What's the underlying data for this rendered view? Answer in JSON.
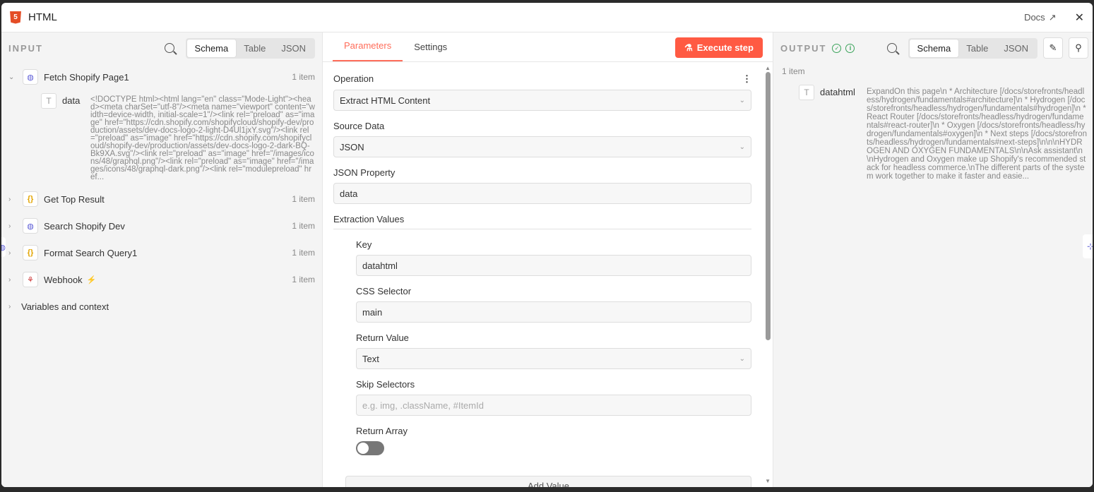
{
  "header": {
    "title": "HTML",
    "docs_label": "Docs"
  },
  "input": {
    "label": "INPUT",
    "views": [
      "Schema",
      "Table",
      "JSON"
    ],
    "nodes": [
      {
        "name": "Fetch Shopify Page1",
        "count": "1 item",
        "icon": "globe-icon"
      },
      {
        "name": "Get Top Result",
        "count": "1 item",
        "icon": "braces-icon"
      },
      {
        "name": "Search Shopify Dev",
        "count": "1 item",
        "icon": "globe-icon"
      },
      {
        "name": "Format Search Query1",
        "count": "1 item",
        "icon": "braces-icon"
      },
      {
        "name": "Webhook",
        "count": "1 item",
        "icon": "webhook-icon"
      }
    ],
    "data_key": "data",
    "data_value": "<!DOCTYPE html><html lang=\"en\" class=\"Mode-Light\"><head><meta charSet=\"utf-8\"/><meta name=\"viewport\" content=\"width=device-width, initial-scale=1\"/><link rel=\"preload\" as=\"image\" href=\"https://cdn.shopify.com/shopifycloud/shopify-dev/production/assets/dev-docs-logo-2-light-D4Ul1jxY.svg\"/><link rel=\"preload\" as=\"image\" href=\"https://cdn.shopify.com/shopifycloud/shopify-dev/production/assets/dev-docs-logo-2-dark-BQ-Bk9XA.svg\"/><link rel=\"preload\" as=\"image\" href=\"/images/icons/48/graphql.png\"/><link rel=\"preload\" as=\"image\" href=\"/images/icons/48/graphql-dark.png\"/><link rel=\"modulepreload\" href...",
    "variables_label": "Variables and context"
  },
  "params": {
    "tabs": [
      "Parameters",
      "Settings"
    ],
    "execute_label": "Execute step",
    "operation_label": "Operation",
    "operation_value": "Extract HTML Content",
    "source_label": "Source Data",
    "source_value": "JSON",
    "json_prop_label": "JSON Property",
    "json_prop_value": "data",
    "extraction_label": "Extraction Values",
    "key_label": "Key",
    "key_value": "datahtml",
    "css_label": "CSS Selector",
    "css_value": "main",
    "return_label": "Return Value",
    "return_value": "Text",
    "skip_label": "Skip Selectors",
    "skip_placeholder": "e.g. img, .className, #ItemId",
    "array_label": "Return Array",
    "return_array": false,
    "add_value_label": "Add Value"
  },
  "output": {
    "label": "OUTPUT",
    "views": [
      "Schema",
      "Table",
      "JSON"
    ],
    "count": "1 item",
    "key": "datahtml",
    "value": "ExpandOn this page\\n * Architecture [/docs/storefronts/headless/hydrogen/fundamentals#architecture]\\n * Hydrogen [/docs/storefronts/headless/hydrogen/fundamentals#hydrogen]\\n * React Router [/docs/storefronts/headless/hydrogen/fundamentals#react-router]\\n * Oxygen [/docs/storefronts/headless/hydrogen/fundamentals#oxygen]\\n * Next steps [/docs/storefronts/headless/hydrogen/fundamentals#next-steps]\\n\\n\\nHYDROGEN AND OXYGEN FUNDAMENTALS\\n\\nAsk assistant\\n\\nHydrogen and Oxygen make up Shopify's recommended stack for headless commerce.\\nThe different parts of the system work together to make it faster and easie..."
  }
}
